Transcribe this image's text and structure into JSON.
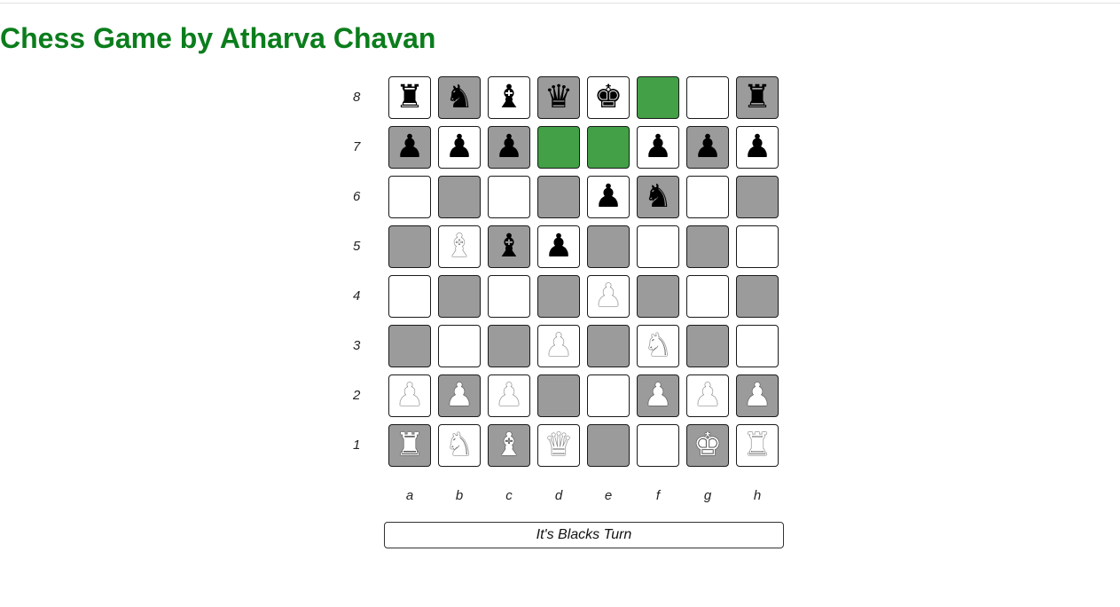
{
  "title": "Chess Game by Atharva Chavan",
  "status": "It's Blacks Turn",
  "colors": {
    "title": "#0b7d1c",
    "light_square": "#ffffff",
    "dark_square": "#9b9b9b",
    "highlight_square": "#43a047"
  },
  "ranks": [
    "8",
    "7",
    "6",
    "5",
    "4",
    "3",
    "2",
    "1"
  ],
  "files": [
    "a",
    "b",
    "c",
    "d",
    "e",
    "f",
    "g",
    "h"
  ],
  "highlighted_squares": [
    "f8",
    "d7",
    "e7"
  ],
  "board": [
    [
      "br",
      "bn",
      "bb",
      "bq",
      "bk",
      "",
      "",
      "br"
    ],
    [
      "bp",
      "bp",
      "bp",
      "",
      "",
      "bp",
      "bp",
      "bp"
    ],
    [
      "",
      "",
      "",
      "",
      "bp",
      "bn",
      "",
      ""
    ],
    [
      "",
      "wb",
      "bb",
      "bp",
      "",
      "",
      "",
      ""
    ],
    [
      "",
      "",
      "",
      "",
      "wp",
      "",
      "",
      ""
    ],
    [
      "",
      "",
      "",
      "wp",
      "",
      "wn",
      "",
      ""
    ],
    [
      "wp",
      "wp",
      "wp",
      "",
      "",
      "wp",
      "wp",
      "wp"
    ],
    [
      "wr",
      "wn",
      "wb",
      "wq",
      "",
      "",
      "wk",
      "wr"
    ]
  ]
}
